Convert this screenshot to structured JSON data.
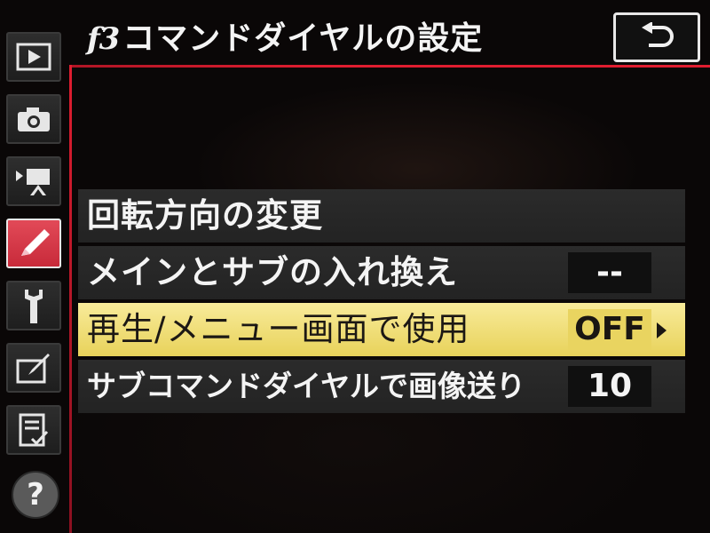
{
  "header": {
    "menu_code": "f3",
    "title": "コマンドダイヤルの設定",
    "back_icon": "return-arrow-icon"
  },
  "sidebar": {
    "tabs": [
      {
        "icon": "playback-icon",
        "active": false
      },
      {
        "icon": "camera-icon",
        "active": false
      },
      {
        "icon": "movie-icon",
        "active": false
      },
      {
        "icon": "pencil-icon",
        "active": true
      },
      {
        "icon": "wrench-icon",
        "active": false
      },
      {
        "icon": "retouch-icon",
        "active": false
      },
      {
        "icon": "my-menu-icon",
        "active": false
      }
    ],
    "help_label": "?"
  },
  "menu": {
    "items": [
      {
        "label": "回転方向の変更",
        "value": ""
      },
      {
        "label": "メインとサブの入れ換え",
        "value": "--"
      },
      {
        "label": "再生/メニュー画面で使用",
        "value": "OFF",
        "selected": true
      },
      {
        "label": "サブコマンドダイヤルで画像送り",
        "value": "10"
      }
    ]
  },
  "colors": {
    "accent_red": "#e01d30",
    "selected_bg": "#f0e070",
    "row_bg": "#272727"
  }
}
